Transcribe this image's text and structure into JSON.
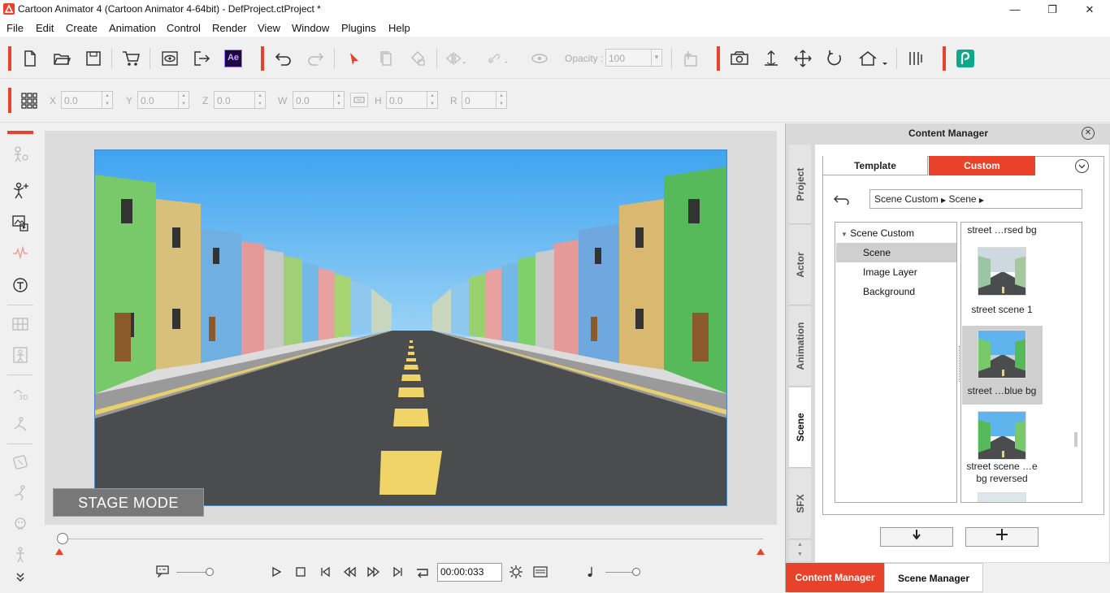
{
  "window": {
    "title": "Cartoon Animator 4  (Cartoon Animator 4-64bit) - DefProject.ctProject *",
    "minimize": "—",
    "restore": "❐",
    "close": "✕"
  },
  "menu": [
    "File",
    "Edit",
    "Create",
    "Animation",
    "Control",
    "Render",
    "View",
    "Window",
    "Plugins",
    "Help"
  ],
  "toolbar": {
    "opacity_label": "Opacity :",
    "opacity_value": "100",
    "ae_label": "Ae"
  },
  "transform": {
    "x_label": "X",
    "x_value": "0.0",
    "y_label": "Y",
    "y_value": "0.0",
    "z_label": "Z",
    "z_value": "0.0",
    "w_label": "W",
    "w_value": "0.0",
    "h_label": "H",
    "h_value": "0.0",
    "r_label": "R",
    "r_value": "0"
  },
  "stage": {
    "mode_label": "STAGE MODE",
    "sky_color": "#5fb4ee",
    "road_color": "#4a4c4e",
    "line_color": "#f0d468"
  },
  "timeline": {
    "time": "00:00:033",
    "playhead": 0.0
  },
  "content_manager": {
    "title": "Content Manager",
    "side_tabs": [
      "Project",
      "Actor",
      "Animation",
      "Scene",
      "SFX"
    ],
    "active_side_tab": "Scene",
    "tabs": {
      "template": "Template",
      "custom": "Custom"
    },
    "breadcrumb": [
      "Scene Custom",
      "Scene"
    ],
    "tree": {
      "root": "Scene Custom",
      "children": [
        "Scene",
        "Image Layer",
        "Background"
      ]
    },
    "items": [
      {
        "label": "street …rsed bg"
      },
      {
        "label": "street scene 1"
      },
      {
        "label": "street …blue bg"
      },
      {
        "label": "street scene …e bg reversed"
      }
    ],
    "bottom_tabs": {
      "content": "Content Manager",
      "scene": "Scene Manager"
    }
  },
  "colors": {
    "accent": "#e8422a",
    "selection": "#cfcfcf"
  }
}
